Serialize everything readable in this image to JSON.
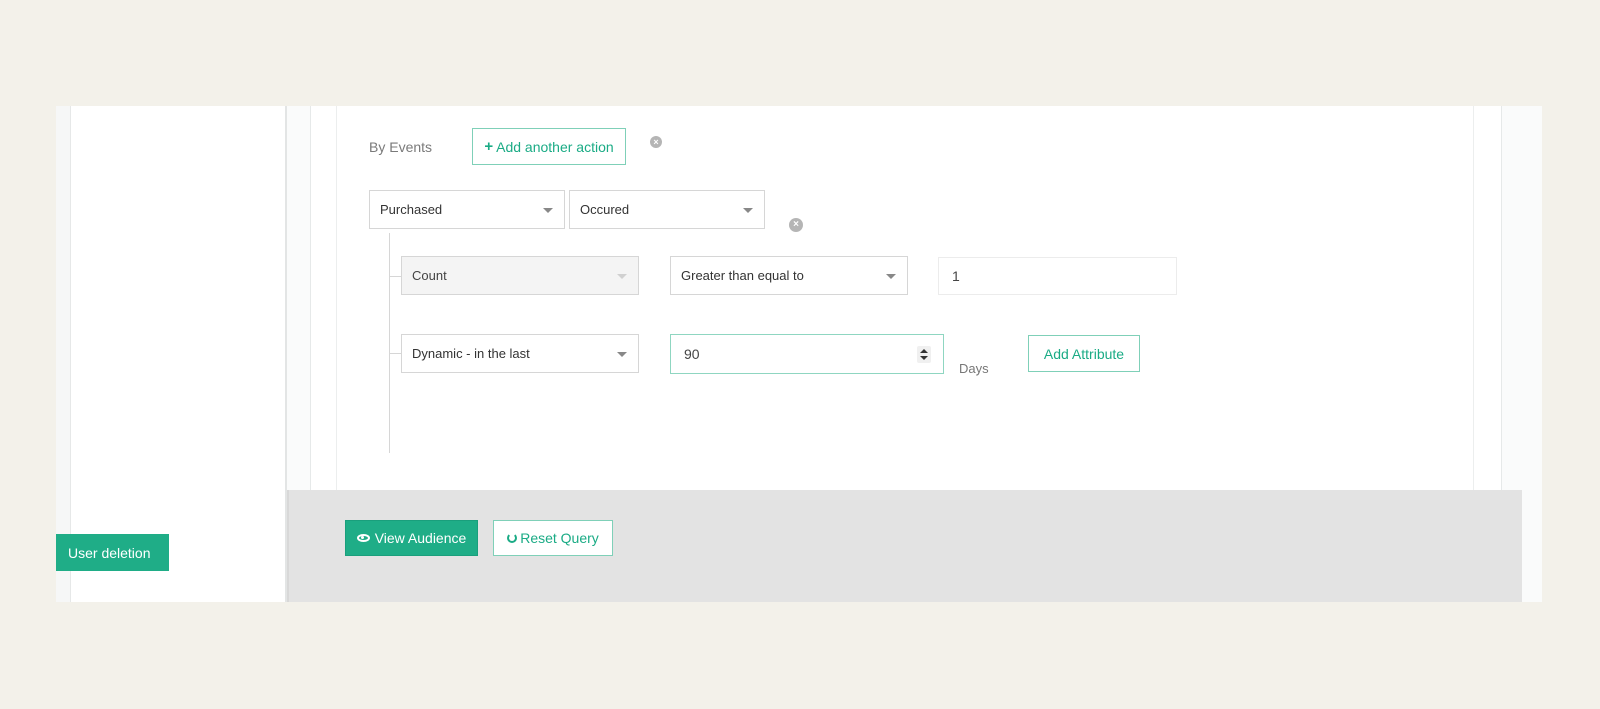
{
  "segment": {
    "by_events_label": "By Events",
    "add_another_action_label": "Add another action",
    "event_select": "Purchased",
    "occurrence_select": "Occured",
    "metric_select": "Count",
    "operator_select": "Greater than equal to",
    "value_input": "1",
    "time_select": "Dynamic - in the last",
    "days_input": "90",
    "days_label": "Days",
    "add_attribute_label": "Add Attribute"
  },
  "footer": {
    "view_audience_label": "View Audience",
    "reset_query_label": "Reset Query"
  },
  "sidebar": {
    "user_deletion_label": "User deletion"
  },
  "icons": {
    "add": "plus-icon",
    "remove": "remove-circle-icon",
    "view": "eye-icon",
    "reset": "refresh-icon",
    "dropdown": "caret-down-icon"
  },
  "colors": {
    "accent": "#1fad87",
    "background": "#f3f1ea",
    "footer_bar": "#e3e3e3"
  }
}
